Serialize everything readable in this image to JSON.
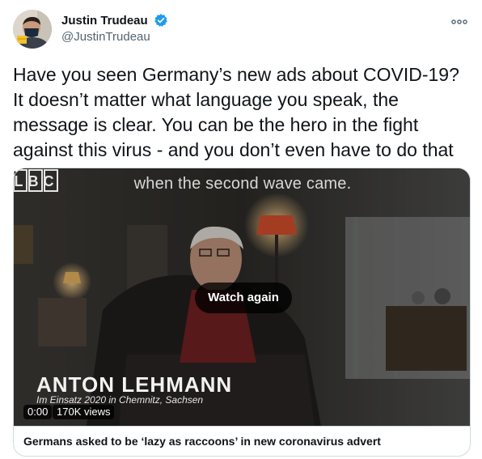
{
  "author": {
    "display_name": "Justin Trudeau",
    "handle": "@JustinTrudeau",
    "avatar_icon": "profile-photo-icon",
    "verified_icon": "verified-badge-icon",
    "verified_color": "#1d9bf0"
  },
  "tweet": {
    "text": "Have you seen Germany’s new ads about COVID-19? It doesn’t matter what language you speak, the message is clear. You can be the hero in the fight against this virus - and you don’t even have to do that much."
  },
  "media": {
    "subtitle": "when the second wave came.",
    "logo": "LBC",
    "watch_again_label": "Watch again",
    "overlay_name": "ANTON LEHMANN",
    "overlay_subtitle": "Im Einsatz 2020 in Chemnitz, Sachsen",
    "time": "0:00",
    "views": "170K views"
  },
  "card": {
    "title": "Germans asked to be ‘lazy as raccoons’ in new coronavirus advert"
  },
  "colors": {
    "text": "#0f1419",
    "secondary": "#536471",
    "border": "#cfd9de"
  }
}
